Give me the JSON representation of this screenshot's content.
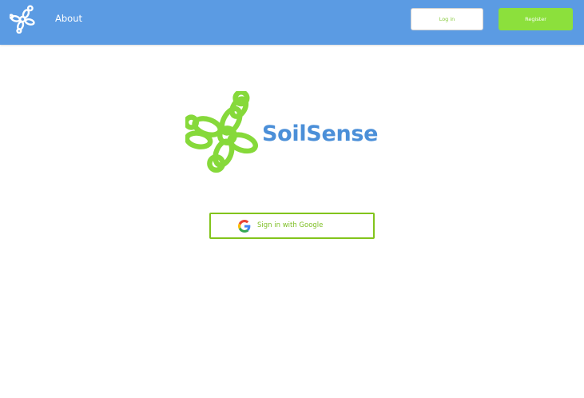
{
  "nav": {
    "about_label": "About",
    "login_label": "Log in",
    "register_label": "Register",
    "logo_icon": "leaf-cluster-logo-icon"
  },
  "brand": {
    "name": "SoilSense",
    "mark_icon": "leaf-cluster-logo-icon"
  },
  "signin": {
    "google_label": "Sign in with Google",
    "icon": "google-g-icon"
  },
  "colors": {
    "header_bg": "#5b9be3",
    "accent_green": "#8ce03c",
    "brand_blue": "#4b8fd8",
    "outline_green": "#82c41c"
  }
}
